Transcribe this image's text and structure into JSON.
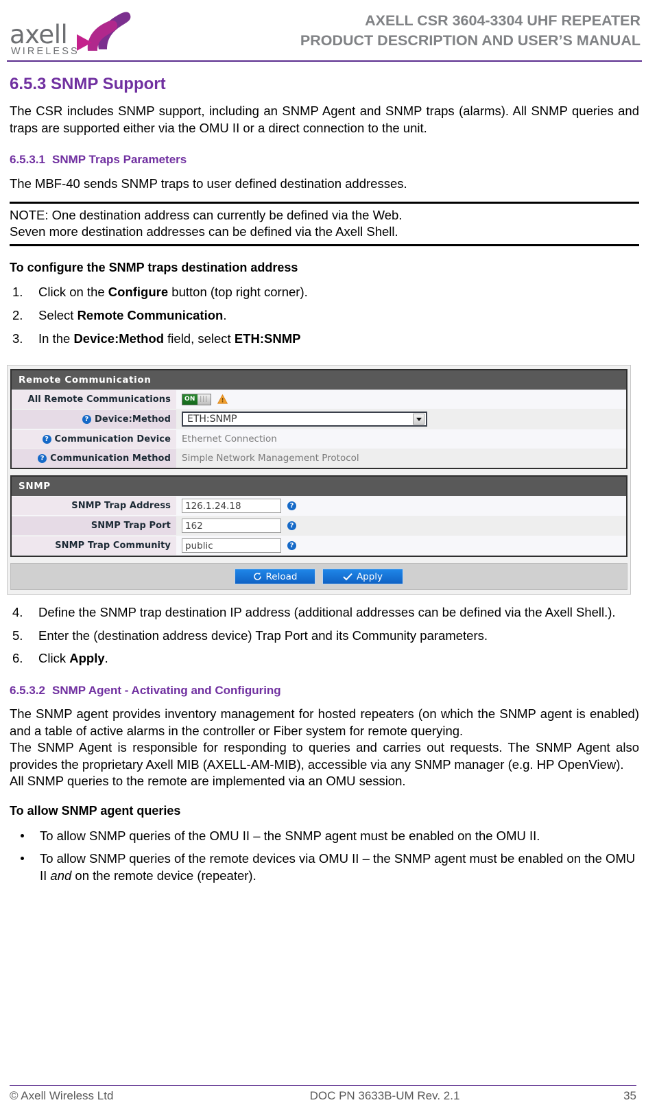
{
  "header": {
    "logo_word": "axell",
    "logo_sub": "WIRELESS",
    "title_line1": "AXELL CSR 3604-3304 UHF REPEATER",
    "title_line2": "PRODUCT DESCRIPTION AND USER’S MANUAL",
    "rule_color": "#5b2d8e",
    "title_color": "#808285"
  },
  "section": {
    "number": "6.5.3",
    "heading": "6.5.3 SNMP Support",
    "intro": "The CSR includes SNMP support, including an SNMP Agent and SNMP traps (alarms). All SNMP queries and traps are supported either via the OMU II or a direct connection to the unit.",
    "heading_color": "#7030a0"
  },
  "subsection_1": {
    "number": "6.5.3.1",
    "title": "SNMP Traps Parameters",
    "intro": "The MBF-40 sends SNMP traps to user defined destination addresses.",
    "note_line1": "NOTE: One destination address can currently be defined via the Web.",
    "note_line2": "Seven more destination addresses can be defined via the Axell Shell.",
    "procedure_title": "To configure the SNMP traps destination address",
    "steps": [
      {
        "idx": "1.",
        "pre": "Click on the ",
        "bold": "Configure",
        "post": " button (top right corner)."
      },
      {
        "idx": "2.",
        "pre": "Select ",
        "bold": "Remote Communication",
        "post": "."
      },
      {
        "idx": "3.",
        "pre": "In the ",
        "bold": "Device:Method",
        "mid": " field, select ",
        "bold2": "ETH:SNMP",
        "post": ""
      }
    ],
    "steps_after": [
      {
        "idx": "4.",
        "text": "Define the SNMP trap destination IP address (additional addresses can be defined via the Axell Shell.)."
      },
      {
        "idx": "5.",
        "text": "Enter the (destination address device) Trap Port and its Community parameters."
      },
      {
        "idx": "6.",
        "pre": "Click ",
        "bold": "Apply",
        "post": "."
      }
    ]
  },
  "screenshot": {
    "remote_panel": {
      "title": "Remote Communication",
      "rows": [
        {
          "label": "All Remote Communications",
          "type": "toggle",
          "toggle_state": "ON",
          "warning_icon": "warning-triangle-icon",
          "help": false
        },
        {
          "label": "Device:Method",
          "type": "select",
          "value": "ETH:SNMP",
          "help": true
        },
        {
          "label": "Communication Device",
          "type": "static",
          "value": "Ethernet Connection",
          "help": true
        },
        {
          "label": "Communication Method",
          "type": "static",
          "value": "Simple Network Management Protocol",
          "help": true
        }
      ]
    },
    "snmp_panel": {
      "title": "SNMP",
      "rows": [
        {
          "label": "SNMP Trap Address",
          "value": "126.1.24.18",
          "help": true
        },
        {
          "label": "SNMP Trap Port",
          "value": "162",
          "help": true
        },
        {
          "label": "SNMP Trap Community",
          "value": "public",
          "help": true
        }
      ]
    },
    "buttons": {
      "reload": "Reload",
      "apply": "Apply",
      "reload_icon": "refresh-icon",
      "apply_icon": "check-icon"
    },
    "colors": {
      "panel_header_bg": "#595959",
      "label_bg_odd": "#efe7ee",
      "label_bg_even": "#e6dbe6",
      "button_blue": "#1470d8",
      "toggle_green": "#1d7d24",
      "help_blue": "#1569c7",
      "warning_orange": "#f0a030"
    }
  },
  "subsection_2": {
    "number": "6.5.3.2",
    "title": "SNMP Agent - Activating and Configuring",
    "para1": "The SNMP agent provides inventory management for hosted repeaters (on which the SNMP agent is enabled) and a table of active alarms in the controller or Fiber system for remote querying.",
    "para2": "The SNMP Agent is responsible for responding to queries and carries out requests. The SNMP Agent also provides the proprietary Axell MIB (AXELL-AM-MIB), accessible via any SNMP manager (e.g. HP OpenView).",
    "para3": "All SNMP queries to the remote are implemented via an OMU session.",
    "procedure_title": "To allow SNMP agent queries",
    "bullets": [
      {
        "text": "To allow SNMP queries of the OMU II – the SNMP agent must be enabled on the OMU II."
      },
      {
        "pre": "To allow SNMP queries of the remote devices via OMU II – the SNMP agent must be enabled on the OMU II ",
        "italic": "and",
        "post": " on the remote device (repeater)."
      }
    ]
  },
  "footer": {
    "left": "© Axell Wireless Ltd",
    "middle": "DOC PN 3633B-UM Rev. 2.1",
    "right": "35"
  }
}
